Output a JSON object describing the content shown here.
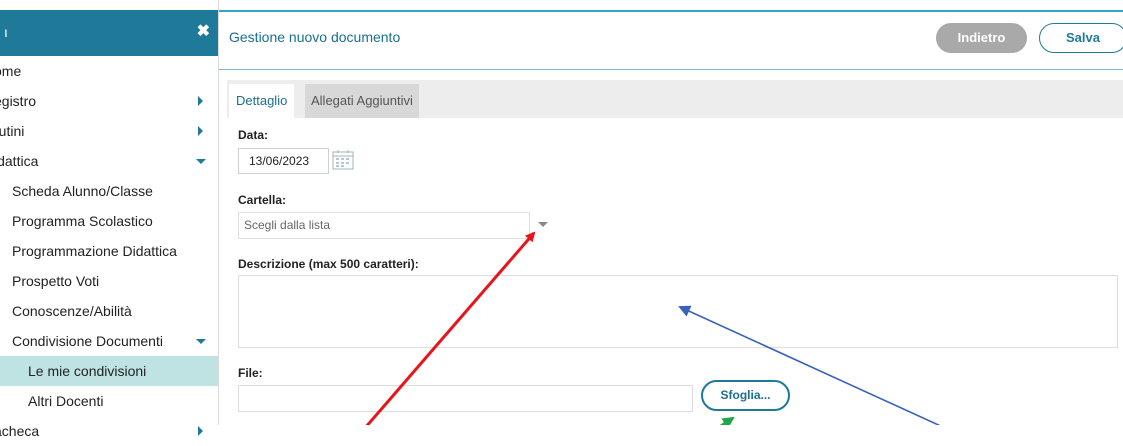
{
  "sidebar": {
    "header_title": "ı",
    "close_symbol": "✖",
    "items": [
      {
        "label": "ome",
        "level": 0,
        "arrow": "none"
      },
      {
        "label": "egistro",
        "level": 0,
        "arrow": "right"
      },
      {
        "label": "rutini",
        "level": 0,
        "arrow": "right"
      },
      {
        "label": "idattica",
        "level": 0,
        "arrow": "down"
      },
      {
        "label": "Scheda Alunno/Classe",
        "level": 1,
        "arrow": "none"
      },
      {
        "label": "Programma Scolastico",
        "level": 1,
        "arrow": "none"
      },
      {
        "label": "Programmazione Didattica",
        "level": 1,
        "arrow": "none"
      },
      {
        "label": "Prospetto Voti",
        "level": 1,
        "arrow": "none"
      },
      {
        "label": "Conoscenze/Abilità",
        "level": 1,
        "arrow": "none"
      },
      {
        "label": "Condivisione Documenti",
        "level": 1,
        "arrow": "down"
      },
      {
        "label": "Le mie condivisioni",
        "level": 2,
        "arrow": "none",
        "active": true
      },
      {
        "label": "Altri Docenti",
        "level": 2,
        "arrow": "none"
      },
      {
        "label": "acheca",
        "level": 0,
        "arrow": "right"
      }
    ]
  },
  "header": {
    "title": "Gestione nuovo documento",
    "back_label": "Indietro",
    "save_label": "Salva"
  },
  "tabs": [
    {
      "label": "Dettaglio",
      "active": true
    },
    {
      "label": "Allegati Aggiuntivi",
      "active": false
    }
  ],
  "form": {
    "date_label": "Data:",
    "date_value": "13/06/2023",
    "folder_label": "Cartella:",
    "folder_placeholder": "Scegli dalla lista",
    "description_label": "Descrizione (max 500 caratteri):",
    "description_value": "",
    "file_label": "File:",
    "file_value": "",
    "browse_label": "Sfoglia..."
  },
  "colors": {
    "accent": "#1f7a99",
    "active_item_bg": "#bfe3e3",
    "annotation_red": "#e8141c",
    "annotation_blue": "#3a62b8",
    "annotation_green": "#1fa64a"
  },
  "icons": [
    "close-icon",
    "chevron-right-icon",
    "chevron-down-icon",
    "calendar-icon",
    "dropdown-caret-icon"
  ]
}
